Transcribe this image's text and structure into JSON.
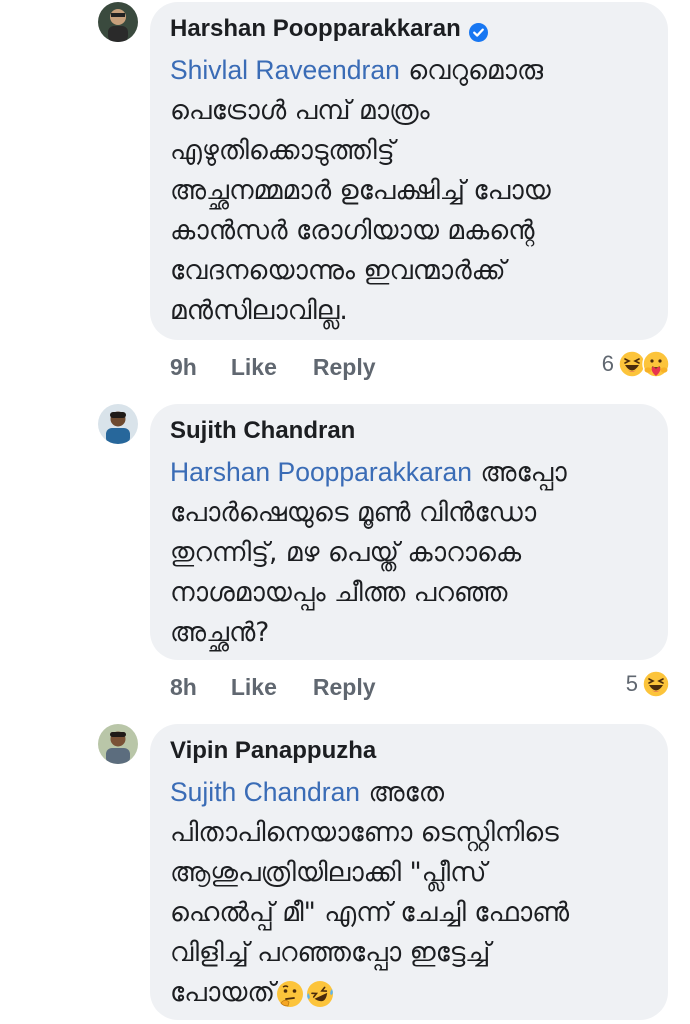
{
  "comments": [
    {
      "author": "Harshan Poopparakkaran",
      "verified": true,
      "mention": "Shivlal Raveendran",
      "text": "  വെറുമൊരു\nപെട്രോൾ പമ്പ് മാത്രം\nഎഴുതിക്കൊടുത്തിട്ട്\nഅച്ഛനമ്മമാർ ഉപേക്ഷിച്ച് പോയ\nകാൻസർ രോഗിയായ മകന്റെ\nവേദനയൊന്നും ഇവന്മാർക്ക്\nമൻസിലാവില്ല.",
      "time": "9h",
      "like_label": "Like",
      "reply_label": "Reply",
      "reaction_count": "6",
      "reaction_icons": [
        "haha-icon",
        "care-icon"
      ]
    },
    {
      "author": "Sujith Chandran",
      "verified": false,
      "mention": "Harshan Poopparakkaran",
      "text": " അപ്പോ\nപോർഷെയുടെ മൂൺ വിൻഡോ\nതുറന്നിട്ട്, മഴ പെയ്ത് കാറാകെ\nനാശമായപ്പം ചീത്ത പറഞ്ഞ\nഅച്ഛൻ?",
      "time": "8h",
      "like_label": "Like",
      "reply_label": "Reply",
      "reaction_count": "5",
      "reaction_icons": [
        "haha-icon"
      ]
    },
    {
      "author": "Vipin Panappuzha",
      "verified": false,
      "mention": "Sujith Chandran",
      "text": " അതേ\nപിതാപിനെയാണോ ടെസ്റ്റിനിടെ\nആശുപത്രിയിലാക്കി \"പ്ലീസ്\nഹെൽപ്പ് മീ\" എന്ന് ചേച്ചി ഫോൺ\nവിളിച്ച് പറഞ്ഞപ്പോ ഇട്ടേച്ച്\nപോയത്",
      "trailing_emojis": [
        "thinking-face-icon",
        "rofl-icon"
      ]
    }
  ],
  "colors": {
    "bubble": "#eff1f4",
    "mention": "#3a6cb6",
    "meta": "#606770",
    "verified": "#1877f2"
  }
}
